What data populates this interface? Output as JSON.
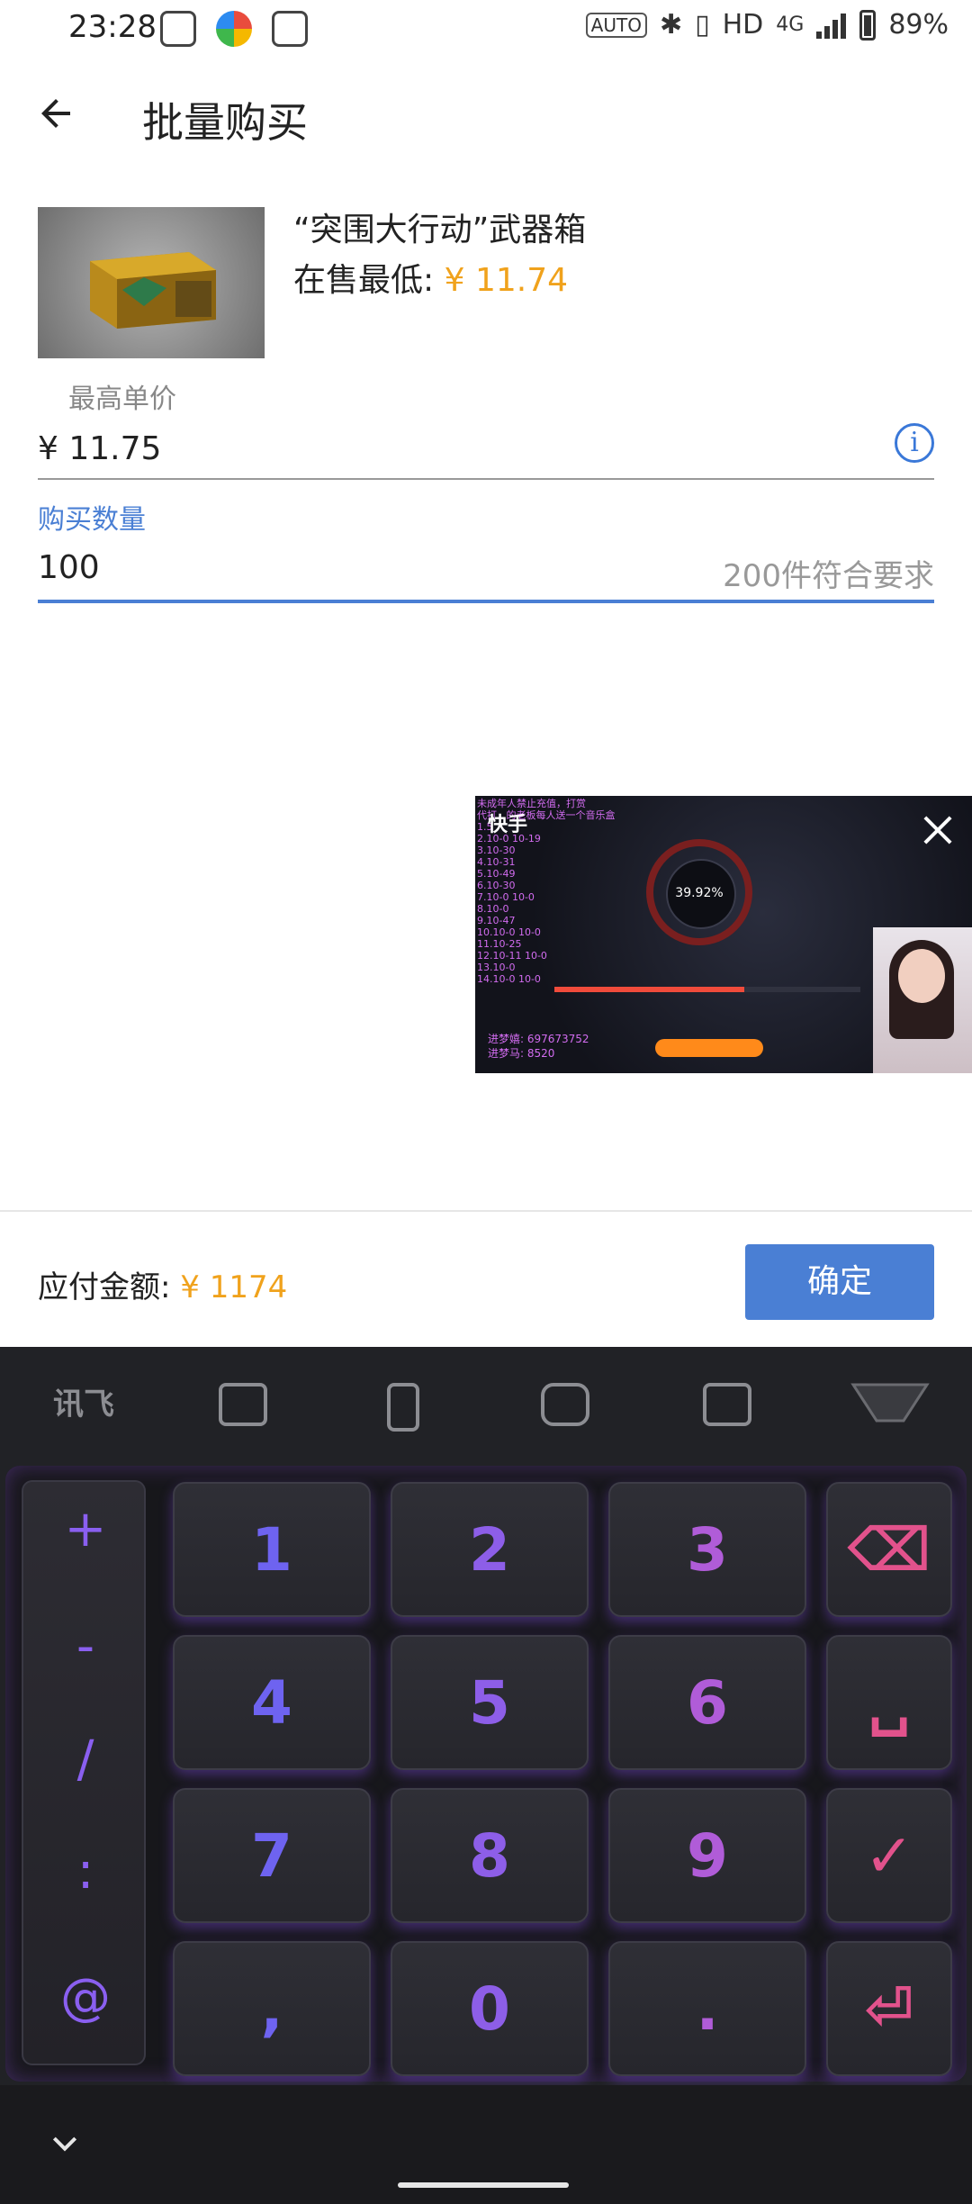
{
  "status_bar": {
    "time": "23:28",
    "auto_chip": "AUTO",
    "hd": "HD",
    "network": "4G",
    "battery": "89%"
  },
  "app_bar": {
    "title": "批量购买"
  },
  "product": {
    "name": "“突围大行动”武器箱",
    "lowest_label": "在售最低:",
    "lowest_price": "¥ 11.74"
  },
  "max_price": {
    "label": "最高单价",
    "value": "¥ 11.75"
  },
  "quantity": {
    "label": "购买数量",
    "value": "100",
    "hint": "200件符合要求"
  },
  "video_overlay": {
    "brand": "快手",
    "percent": "39.92%",
    "lines": "未成年人禁止充值，打赏\n代打...的老板每人送一个音乐盒\n1.5\n2.10-0 10-19\n3.10-30\n4.10-31\n5.10-49\n6.10-30\n7.10-0 10-0\n8.10-0\n9.10-47\n10.10-0 10-0\n11.10-25\n12.10-11 10-0\n13.10-0\n14.10-0 10-0",
    "ids": "进梦嬉: 697673752\n进梦马: 8520"
  },
  "pay_bar": {
    "label": "应付金额:",
    "amount": "¥ 1174",
    "confirm": "确定"
  },
  "keyboard": {
    "brand": "讯飞",
    "side_keys": [
      "+",
      "-",
      "/",
      ":",
      "@"
    ],
    "rows": [
      [
        "1",
        "2",
        "3",
        "⌫"
      ],
      [
        "4",
        "5",
        "6",
        "␣"
      ],
      [
        "7",
        "8",
        "9",
        "✓"
      ],
      [
        ",",
        "0",
        ".",
        "⏎"
      ]
    ]
  },
  "colors": {
    "accent": "#4a7fd4",
    "price": "#f0a21c",
    "keyboard_bg": "#212226"
  }
}
